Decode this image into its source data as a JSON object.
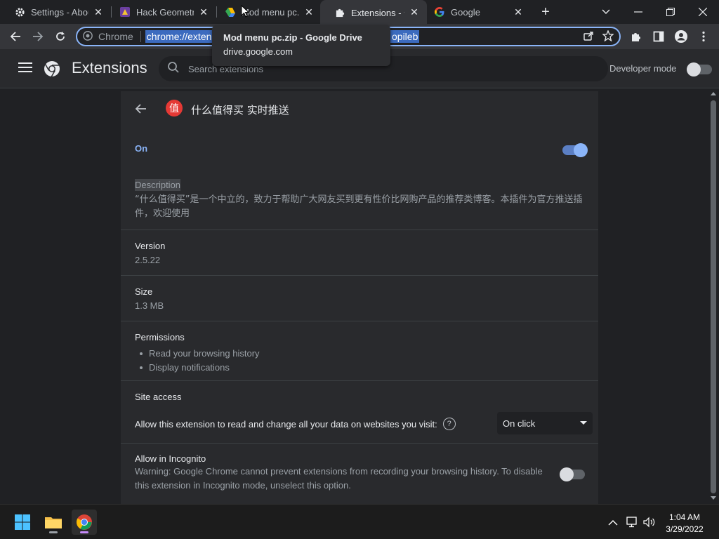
{
  "tabs": [
    {
      "title": "Settings - About Chrome",
      "favicon": "gear-icon",
      "active": false
    },
    {
      "title": "Hack Geometry Dash",
      "favicon": "game-icon",
      "active": false
    },
    {
      "title": "Mod menu pc.zip",
      "favicon": "google-drive-icon",
      "active": false
    },
    {
      "title": "Extensions - 什么值得买",
      "favicon": "puzzle-icon",
      "active": true
    },
    {
      "title": "Google",
      "favicon": "google-icon",
      "active": false
    }
  ],
  "toolbar": {
    "site_chip": "Chrome",
    "url_visible": "chrome://exten",
    "url_tail": "opileb"
  },
  "tooltip": {
    "title": "Mod menu pc.zip - Google Drive",
    "domain": "drive.google.com"
  },
  "header": {
    "title": "Extensions",
    "search_placeholder": "Search extensions",
    "developer_mode_label": "Developer mode",
    "developer_mode_enabled": false
  },
  "extension": {
    "name": "什么值得买 实时推送",
    "icon_char": "值",
    "status_label": "On",
    "enabled": true,
    "description_title": "Description",
    "description": "“什么值得买”是一个中立的，致力于帮助广大网友买到更有性价比网购产品的推荐类博客。本插件为官方推送插件，欢迎使用",
    "version_title": "Version",
    "version": "2.5.22",
    "size_title": "Size",
    "size": "1.3 MB",
    "permissions_title": "Permissions",
    "permissions": [
      "Read your browsing history",
      "Display notifications"
    ],
    "site_access_title": "Site access",
    "site_access_text": "Allow this extension to read and change all your data on websites you visit:",
    "site_access_value": "On click",
    "incognito_title": "Allow in Incognito",
    "incognito_warning": "Warning: Google Chrome cannot prevent extensions from recording your browsing history. To disable this extension in Incognito mode, unselect this option.",
    "incognito_enabled": false
  },
  "taskbar": {
    "time": "1:04 AM",
    "date": "3/29/2022"
  },
  "colors": {
    "accent": "#8ab4f8",
    "background": "#202124",
    "card": "#292a2d"
  }
}
